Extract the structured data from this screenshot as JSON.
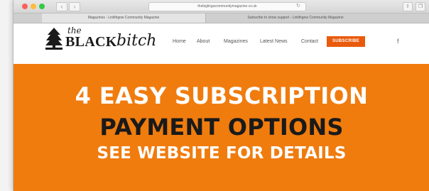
{
  "browser": {
    "address": "thebiglingacommunitymagazine.co.uk",
    "tabs": [
      "Magazines - Linlithgow Community Magazine",
      "Subscribe to show support - Linlithgow Community Magazine"
    ],
    "icons": {
      "back": "chevron-left-icon",
      "forward": "chevron-right-icon",
      "reload": "reload-icon",
      "share": "share-icon",
      "tabs": "tabs-icon"
    }
  },
  "site": {
    "logo": {
      "the": "the",
      "black": "BLACK",
      "bitch": "bitch"
    },
    "menu": {
      "home": "Home",
      "about": "About",
      "magazines": "Magazines",
      "latest_news": "Latest News",
      "contact": "Contact",
      "subscribe": "SUBSCRIBE",
      "facebook": "f"
    },
    "banner": {
      "line1": "4 EASY SUBSCRIPTION",
      "line2": "PAYMENT OPTIONS",
      "line3": "SEE WEBSITE FOR DETAILS"
    }
  },
  "colors": {
    "banner": "#f07c0e",
    "subscribe_button": "#e95a0c",
    "banner_text_light": "#ffffff",
    "banner_text_dark": "#1a1a1a"
  }
}
